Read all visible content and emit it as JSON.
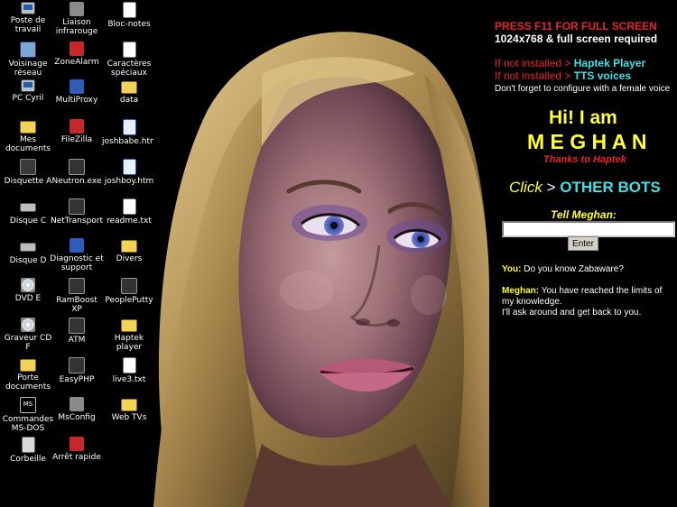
{
  "desktop": {
    "icons": [
      {
        "label": "Poste de travail",
        "icon": "computer-icon",
        "col": 0,
        "row": 0
      },
      {
        "label": "Voisinage réseau",
        "icon": "network-icon",
        "col": 0,
        "row": 1
      },
      {
        "label": "PC Cyril",
        "icon": "computer-icon",
        "col": 0,
        "row": 2
      },
      {
        "label": "Mes documents",
        "icon": "folder-icon",
        "col": 0,
        "row": 3
      },
      {
        "label": "Disquette A",
        "icon": "floppy-icon",
        "col": 0,
        "row": 4
      },
      {
        "label": "Disque C",
        "icon": "drive-icon",
        "col": 0,
        "row": 5
      },
      {
        "label": "Disque D",
        "icon": "drive-icon",
        "col": 0,
        "row": 6
      },
      {
        "label": "DVD E",
        "icon": "cd-icon",
        "col": 0,
        "row": 7
      },
      {
        "label": "Graveur CD F",
        "icon": "cd-icon",
        "col": 0,
        "row": 8
      },
      {
        "label": "Porte documents",
        "icon": "briefcase-icon",
        "col": 0,
        "row": 9
      },
      {
        "label": "Commandes MS-DOS",
        "icon": "msdos-icon",
        "col": 0,
        "row": 10
      },
      {
        "label": "Corbeille",
        "icon": "trash-icon",
        "col": 0,
        "row": 11
      },
      {
        "label": "Liaison infrarouge",
        "icon": "infrared-icon",
        "col": 1,
        "row": 0
      },
      {
        "label": "ZoneAlarm",
        "icon": "zonealarm-icon",
        "col": 1,
        "row": 1
      },
      {
        "label": "MultiProxy",
        "icon": "proxy-icon",
        "col": 1,
        "row": 2
      },
      {
        "label": "FileZilla",
        "icon": "filezilla-icon",
        "col": 1,
        "row": 3
      },
      {
        "label": "Neutron.exe",
        "icon": "app-icon",
        "col": 1,
        "row": 4
      },
      {
        "label": "NetTransport",
        "icon": "app-icon",
        "col": 1,
        "row": 5
      },
      {
        "label": "Diagnostic et support",
        "icon": "diagnostic-icon",
        "col": 1,
        "row": 6
      },
      {
        "label": "RamBoost XP",
        "icon": "app-icon",
        "col": 1,
        "row": 7
      },
      {
        "label": "ATM",
        "icon": "atm-icon",
        "col": 1,
        "row": 8
      },
      {
        "label": "EasyPHP",
        "icon": "app-icon",
        "col": 1,
        "row": 9
      },
      {
        "label": "MsConfig",
        "icon": "settings-icon",
        "col": 1,
        "row": 10
      },
      {
        "label": "Arrêt rapide",
        "icon": "shutdown-icon",
        "col": 1,
        "row": 11
      },
      {
        "label": "Bloc-notes",
        "icon": "notepad-icon",
        "col": 2,
        "row": 0
      },
      {
        "label": "Caractères spéciaux",
        "icon": "charmap-icon",
        "col": 2,
        "row": 1
      },
      {
        "label": "data",
        "icon": "folder-icon",
        "col": 2,
        "row": 2
      },
      {
        "label": "joshbabe.htm",
        "icon": "html-file-icon",
        "col": 2,
        "row": 3
      },
      {
        "label": "joshboy.htm",
        "icon": "html-file-icon",
        "col": 2,
        "row": 4
      },
      {
        "label": "readme.txt",
        "icon": "text-file-icon",
        "col": 2,
        "row": 5
      },
      {
        "label": "Divers",
        "icon": "folder-icon",
        "col": 2,
        "row": 6
      },
      {
        "label": "PeoplePutty",
        "icon": "app-icon",
        "col": 2,
        "row": 7
      },
      {
        "label": "Haptek player",
        "icon": "folder-icon",
        "col": 2,
        "row": 8
      },
      {
        "label": "live3.txt",
        "icon": "text-file-icon",
        "col": 2,
        "row": 9
      },
      {
        "label": "Web TVs",
        "icon": "folder-icon",
        "col": 2,
        "row": 10
      }
    ]
  },
  "panel": {
    "press_f11": "PRESS F11 FOR FULL SCREEN",
    "resolution": "1024x768 & full screen required",
    "if_not_installed_1": "If not installed >",
    "haptek_player_link": "Haptek Player",
    "if_not_installed_2": "If not installed >",
    "tts_voices_link": "TTS voices",
    "configure_note": "Don't forget to configure with a female voice",
    "greeting": "Hi! I am",
    "bot_name": "M E G H A N",
    "thanks": "Thanks to Haptek",
    "click_label": "Click",
    "click_arrow": ">",
    "other_bots_link": "OTHER BOTS",
    "tell_label": "Tell Meghan:",
    "input_value": "",
    "enter_button": "Enter",
    "you_label": "You:",
    "you_text": "Do you know Zabaware?",
    "meghan_label": "Meghan:",
    "meghan_line1": "You have reached the limits of",
    "meghan_line2": "my knowledge.",
    "meghan_line3": "I'll ask around and get back to you."
  },
  "colors": {
    "red": "#e8252b",
    "cyan": "#3fe0e6",
    "yellow": "#ffff33",
    "background": "#000000"
  }
}
